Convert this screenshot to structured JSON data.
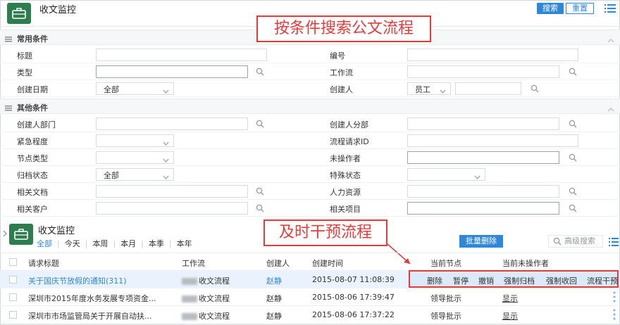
{
  "header": {
    "title": "收文监控",
    "search_button": "搜索",
    "reset_button": "重置"
  },
  "annotations": {
    "search_note": "按条件搜索公文流程",
    "intervene_note": "及时干预流程"
  },
  "sections": {
    "common": "常用条件",
    "other": "其他条件"
  },
  "common_fields": {
    "title_label": "标题",
    "number_label": "编号",
    "type_label": "类型",
    "workflow_label": "工作流",
    "created_date_label": "创建日期",
    "created_date_value": "全部",
    "creator_label": "创建人",
    "creator_type_value": "员工"
  },
  "other_fields": {
    "creator_dept_label": "创建人部门",
    "creator_branch_label": "创建人分部",
    "urgency_label": "紧急程度",
    "request_id_label": "流程请求ID",
    "node_type_label": "节点类型",
    "unoperated_label": "未操作者",
    "archive_status_label": "归档状态",
    "archive_status_value": "全部",
    "special_status_label": "特殊状态",
    "related_doc_label": "相关文档",
    "hr_label": "人力资源",
    "related_customer_label": "相关客户",
    "related_project_label": "相关项目"
  },
  "list": {
    "title": "收文监控",
    "tabs": [
      "全部",
      "今天",
      "本周",
      "本月",
      "本季",
      "本年"
    ],
    "bulk_delete": "批量删除",
    "advanced_search": "高级搜索"
  },
  "table": {
    "columns": [
      "请求标题",
      "工作流",
      "创建人",
      "创建时间",
      "当前节点",
      "当前未操作者"
    ],
    "rows": [
      {
        "title": "关于国庆节放假的通知(311)",
        "workflow": "收文流程",
        "creator": "赵静",
        "created": "2015-08-07 11:08:39",
        "node": "",
        "operator": ""
      },
      {
        "title": "深圳市2015年度水务发展专项资金...",
        "workflow": "收文流程",
        "creator": "赵静",
        "created": "2015-08-06 17:39:47",
        "node": "领导批示",
        "operator": "显示"
      },
      {
        "title": "深圳市市场监管局关于开展自动扶...",
        "workflow": "收文流程",
        "creator": "赵静",
        "created": "2015-08-06 17:37:22",
        "node": "领导批示",
        "operator": "显示"
      }
    ],
    "row_actions": [
      "删除",
      "暂停",
      "撤销",
      "强制归档",
      "强制收回",
      "流程干预"
    ]
  },
  "colors": {
    "accent": "#2f87d9",
    "annotation": "#e23b3b",
    "app_icon": "#2e7d4f"
  }
}
